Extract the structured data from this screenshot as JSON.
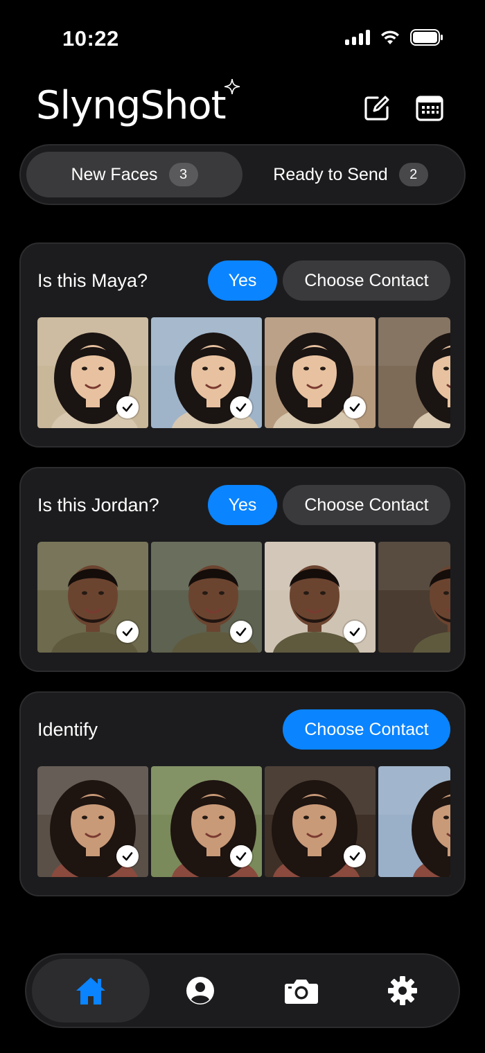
{
  "status": {
    "time": "10:22"
  },
  "app": {
    "name": "SlyngShot"
  },
  "colors": {
    "accent": "#0a84ff",
    "card": "#1c1c1e",
    "segment_active": "#3a3a3c"
  },
  "segments": [
    {
      "label": "New Faces",
      "count": "3",
      "active": true
    },
    {
      "label": "Ready to Send",
      "count": "2",
      "active": false
    }
  ],
  "cards": [
    {
      "title": "Is this Maya?",
      "yes_label": "Yes",
      "choose_label": "Choose Contact",
      "photo_count": 4
    },
    {
      "title": "Is this Jordan?",
      "yes_label": "Yes",
      "choose_label": "Choose Contact",
      "photo_count": 4
    },
    {
      "title": "Identify",
      "choose_label": "Choose Contact",
      "photo_count": 4
    }
  ],
  "tabs": [
    {
      "icon": "home-icon",
      "active": true
    },
    {
      "icon": "profile-icon",
      "active": false
    },
    {
      "icon": "camera-icon",
      "active": false
    },
    {
      "icon": "gear-icon",
      "active": false
    }
  ]
}
